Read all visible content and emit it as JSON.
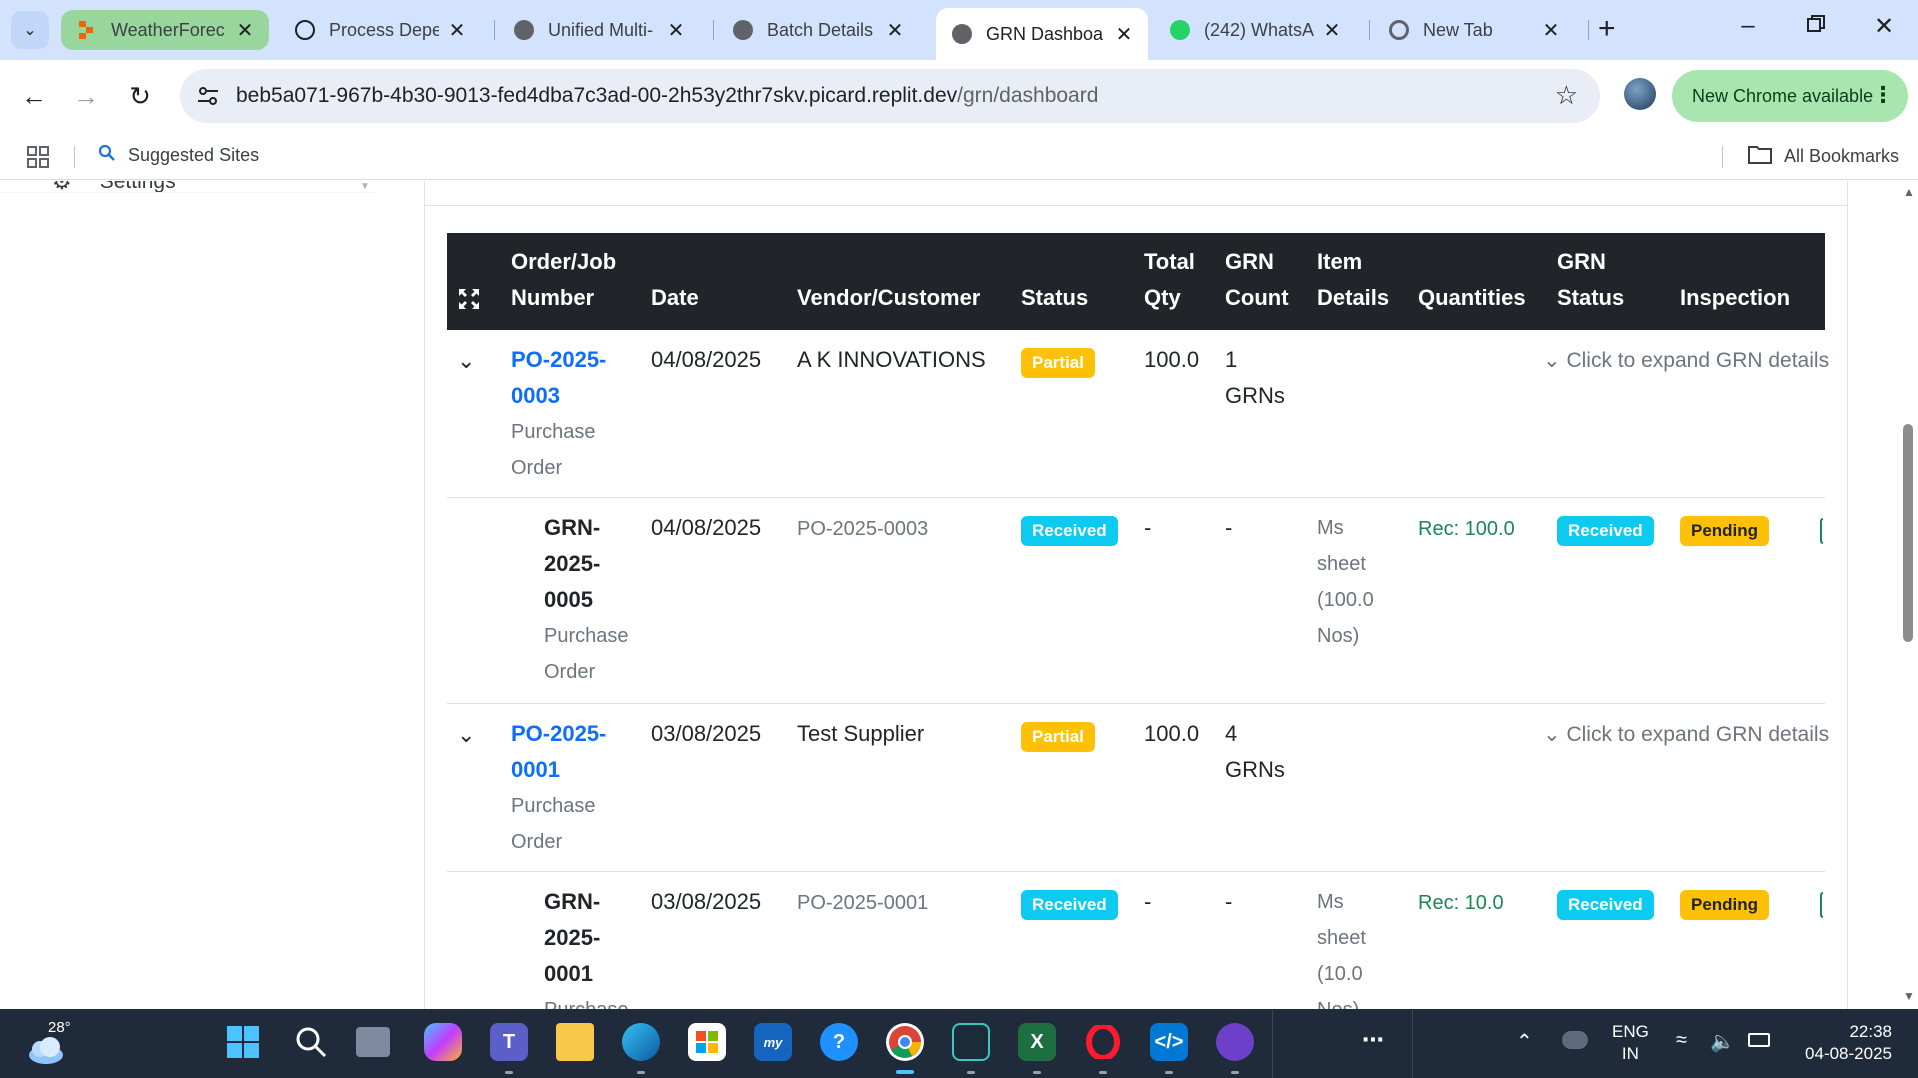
{
  "browser": {
    "tabs": [
      {
        "label": "WeatherForec",
        "state": "grouped"
      },
      {
        "label": "Process Deper",
        "state": "normal"
      },
      {
        "label": "Unified Multi-",
        "state": "normal"
      },
      {
        "label": "Batch Details -",
        "state": "normal"
      },
      {
        "label": "GRN Dashboa",
        "state": "active"
      },
      {
        "label": "(242) WhatsA",
        "state": "normal"
      },
      {
        "label": "New Tab",
        "state": "normal"
      }
    ],
    "url_host": "beb5a071-967b-4b30-9013-fed4dba7c3ad-00-2h53y2thr7skv.picard.replit.dev",
    "url_path": "/grn/dashboard",
    "update_label": "New Chrome available",
    "bookmarks": [
      {
        "label": "Suggested Sites"
      },
      {
        "label": "All Bookmarks"
      }
    ]
  },
  "sidebar": {
    "settings_label": "Settings"
  },
  "table": {
    "headers": {
      "order": [
        "Order/Job",
        "Number"
      ],
      "date": "Date",
      "vendor": "Vendor/Customer",
      "status": "Status",
      "total_qty": [
        "Total",
        "Qty"
      ],
      "grn_count": [
        "GRN",
        "Count"
      ],
      "item_details": [
        "Item",
        "Details"
      ],
      "quantities": "Quantities",
      "grn_status": [
        "GRN",
        "Status"
      ],
      "inspection": "Inspection"
    },
    "orders": [
      {
        "number": [
          "PO-2025-",
          "0003"
        ],
        "type": [
          "Purchase",
          "Order"
        ],
        "date": "04/08/2025",
        "vendor": "A K INNOVATIONS",
        "status": "Partial",
        "total_qty": "100.0",
        "grn_count": [
          "1",
          "GRNs"
        ],
        "expand_hint": "Click to expand GRN details",
        "grn": {
          "number": [
            "GRN-",
            "2025-",
            "0005"
          ],
          "type": [
            "Purchase",
            "Order"
          ],
          "date": "04/08/2025",
          "ref": "PO-2025-0003",
          "status": "Received",
          "total_qty": "-",
          "grn_count": "-",
          "item_details": [
            "Ms",
            "sheet",
            "(100.0",
            "Nos)"
          ],
          "quantities": "Rec: 100.0",
          "grn_status": "Received",
          "inspection": "Pending"
        }
      },
      {
        "number": [
          "PO-2025-",
          "0001"
        ],
        "type": [
          "Purchase",
          "Order"
        ],
        "date": "03/08/2025",
        "vendor": "Test Supplier",
        "status": "Partial",
        "total_qty": "100.0",
        "grn_count": [
          "4",
          "GRNs"
        ],
        "expand_hint": "Click to expand GRN details",
        "grn": {
          "number": [
            "GRN-",
            "2025-",
            "0001"
          ],
          "type": [
            "Purchase",
            "Order"
          ],
          "date": "03/08/2025",
          "ref": "PO-2025-0001",
          "status": "Received",
          "total_qty": "-",
          "grn_count": "-",
          "item_details": [
            "Ms",
            "sheet",
            "(10.0",
            "Nos)"
          ],
          "quantities": "Rec: 10.0",
          "grn_status": "Received",
          "inspection": "Pending"
        }
      }
    ]
  },
  "taskbar": {
    "weather_temp": "28°",
    "language": [
      "ENG",
      "IN"
    ],
    "time": "22:38",
    "date": "04-08-2025"
  },
  "colors": {
    "tabstrip_bg": "#d3e3fd",
    "table_header_bg": "#212529",
    "link": "#0d6efd",
    "badge_warning": "#ffc107",
    "badge_info": "#0dcaf0",
    "success_text": "#198754",
    "taskbar_bg": "#1f2a3a"
  }
}
